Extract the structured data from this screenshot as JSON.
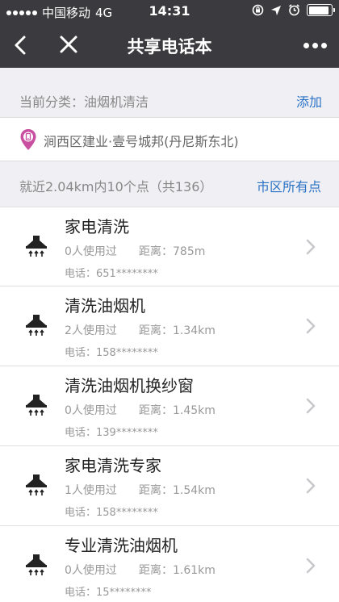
{
  "status": {
    "carrier": "中国移动",
    "network": "4G",
    "time": "14:31",
    "battery_percent": 90
  },
  "nav": {
    "title": "共享电话本",
    "back_icon": "back-arrow-icon",
    "close_icon": "close-icon",
    "more_icon": "more-dots-icon"
  },
  "category": {
    "label": "当前分类：油烟机清洁",
    "add_label": "添加"
  },
  "location": {
    "icon": "location-pin-icon",
    "text": "涧西区建业·壹号城邦(丹尼斯东北)"
  },
  "summary": {
    "text": "就近2.04km内10个点（共136）",
    "city_link": "市区所有点"
  },
  "items": [
    {
      "name": "家电清洗",
      "uses": "0人使用过",
      "distance": "距离：785m",
      "phone": "电话：651********"
    },
    {
      "name": "清洗油烟机",
      "uses": "2人使用过",
      "distance": "距离：1.34km",
      "phone": "电话：158********"
    },
    {
      "name": "清洗油烟机换纱窗",
      "uses": "0人使用过",
      "distance": "距离：1.45km",
      "phone": "电话：139********"
    },
    {
      "name": "家电清洗专家",
      "uses": "1人使用过",
      "distance": "距离：1.54km",
      "phone": "电话：158********"
    },
    {
      "name": "专业清洗油烟机",
      "uses": "0人使用过",
      "distance": "距离：1.61km",
      "phone": "电话：15********"
    }
  ],
  "colors": {
    "nav_bg": "#3b3b3f",
    "link": "#2b73c5",
    "location_icon": "#c94fa0"
  }
}
